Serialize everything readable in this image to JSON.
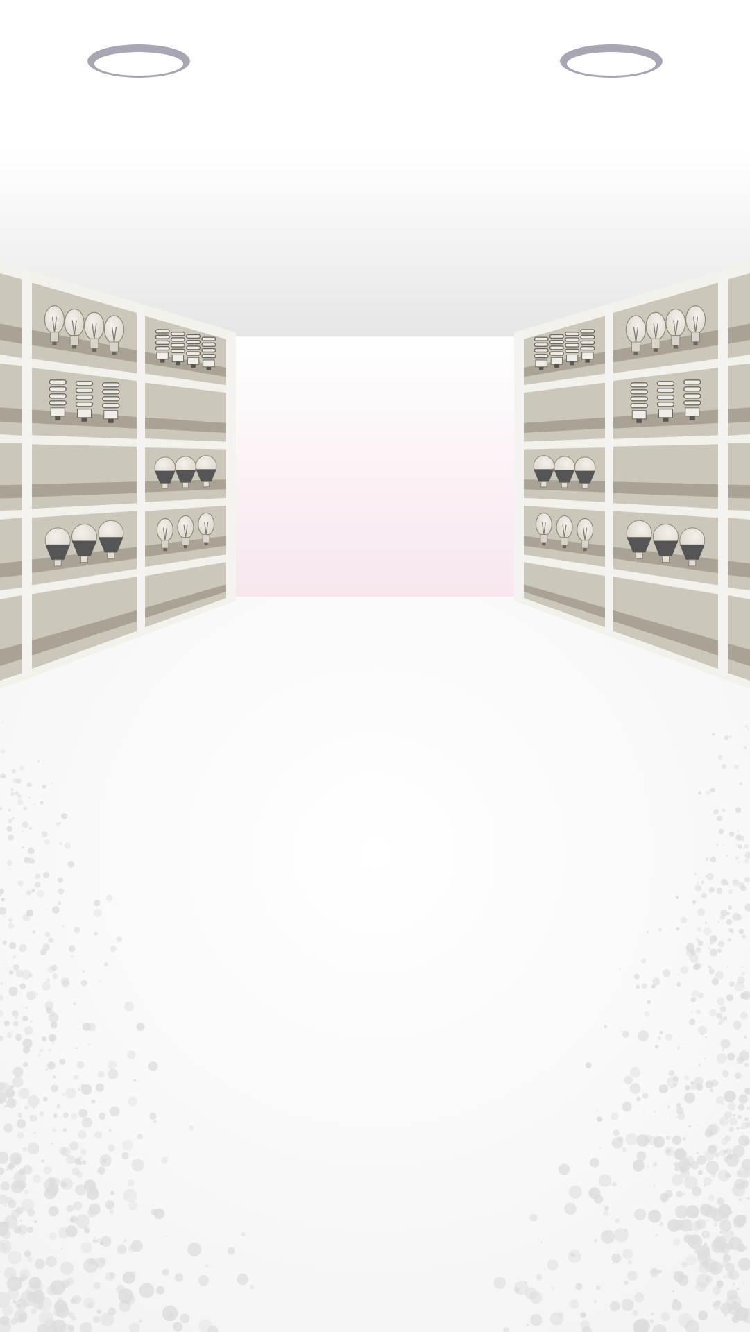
{
  "scene": {
    "type": "store-aisle-background",
    "colors": {
      "ceiling_top": "#ffffff",
      "ceiling_bottom": "#e6e6e6",
      "back_wall_top": "#ffffff",
      "back_wall_bottom": "#f7e6ee",
      "floor": "#fafafa",
      "floor_speckle": "#dcdcdc",
      "shelf_frame": "#f2f1ec",
      "shelf_panel": "#cbc7bb",
      "shelf_band": "#a9a395",
      "bulb_glass": "#e9e5dc",
      "bulb_outline": "#8f897d",
      "bulb_base_dark": "#555555",
      "ceiling_light_ring": "#a7a6b3"
    },
    "ceiling_lights": [
      {
        "name": "ceiling-light-left"
      },
      {
        "name": "ceiling-light-right"
      }
    ],
    "shelf_contents": [
      [
        "bulb-classic-x4",
        "bulb-cfl-x4"
      ],
      [
        "bulb-cfl-x3",
        "empty"
      ],
      [
        "empty",
        "bulb-led-x3"
      ],
      [
        "bulb-led-x3",
        "bulb-classic-x3"
      ],
      [
        "empty",
        "empty"
      ]
    ]
  }
}
